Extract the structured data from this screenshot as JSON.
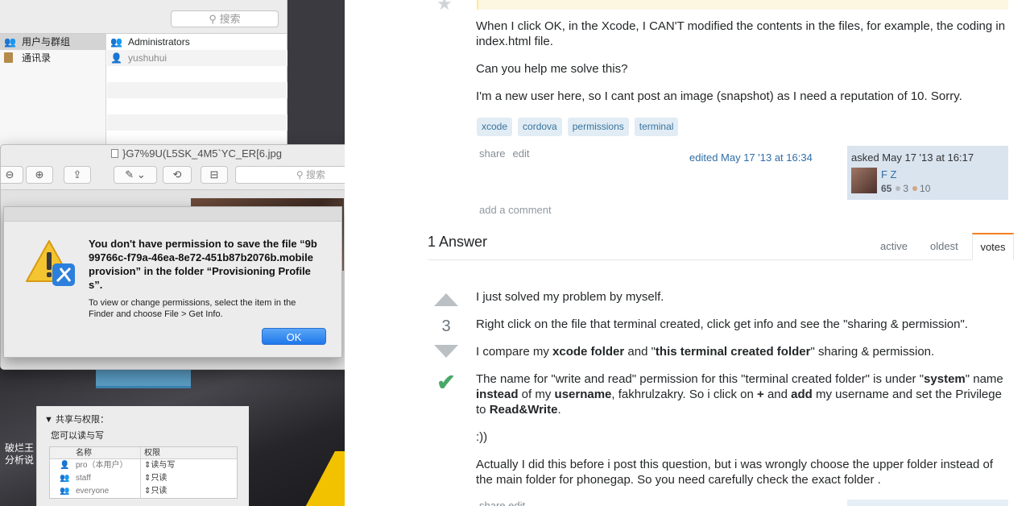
{
  "users_window": {
    "search_placeholder": "搜索",
    "sidebar": [
      {
        "label": "用户与群组",
        "icon": "users-icon",
        "selected": true
      },
      {
        "label": "通讯录",
        "icon": "address-book-icon",
        "selected": false
      }
    ],
    "list": [
      {
        "label": "Administrators",
        "icon": "group-icon"
      },
      {
        "label": "yushuhui",
        "icon": "user-icon"
      }
    ]
  },
  "preview_window": {
    "title": "}G7%9U(L5SK_4M5`YC_ER[6.jpg",
    "search_placeholder": "搜索"
  },
  "alert": {
    "message": "You don't have permission to save the file “9b99766c-f79a-46ea-8e72-451b87b2076b.mobileprovision” in the folder “Provisioning Profiles”.",
    "info": "To view or change permissions, select the item in the Finder and choose File > Get Info.",
    "ok_label": "OK"
  },
  "desktop": {
    "caption_line1": "破烂王",
    "caption_line2": "分析说"
  },
  "get_info": {
    "section_header": "▼ 共享与权限：",
    "subtitle": "您可以读与写",
    "columns": [
      "名称",
      "权限"
    ],
    "rows": [
      {
        "name": "pro（本用户）",
        "privilege": "读与写",
        "icon": "user-icon"
      },
      {
        "name": "staff",
        "privilege": "只读",
        "icon": "group-icon"
      },
      {
        "name": "everyone",
        "privilege": "只读",
        "icon": "everyone-icon"
      }
    ]
  },
  "question": {
    "paragraphs": [
      "When I click OK, in the Xcode, I CAN'T modified the contents in the files, for example, the coding in index.html file.",
      "Can you help me solve this?",
      "I'm a new user here, so I cant post an image (snapshot) as I need a reputation of 10. Sorry."
    ],
    "tags": [
      "xcode",
      "cordova",
      "permissions",
      "terminal"
    ],
    "share_label": "share",
    "edit_label": "edit",
    "edited": "edited May 17 '13 at 16:34",
    "asked": "asked May 17 '13 at 16:17",
    "user_name": "F Z",
    "reputation": "65",
    "silver_badges": "3",
    "bronze_badges": "10",
    "silver_color": "#b4b8bc",
    "bronze_color": "#d1a684",
    "add_comment": "add a comment"
  },
  "answers": {
    "header": "1 Answer",
    "tabs": [
      "active",
      "oldest",
      "votes"
    ],
    "active_tab": "votes",
    "vote_count": "3",
    "accepted_color": "#48a868",
    "p1": "I just solved my problem by myself.",
    "p2": "Right click on the file that terminal created, click get info and see the \"sharing & permission\".",
    "p3_a": "I compare my ",
    "p3_b": "xcode folder",
    "p3_c": " and \"",
    "p3_d": "this terminal created folder",
    "p3_e": "\" sharing & permission.",
    "p4_a": "The name for \"write and read\" permission for this \"terminal created folder\" is under \"",
    "p4_b": "system",
    "p4_c": "\" name ",
    "p4_d": "instead",
    "p4_e": " of my ",
    "p4_f": "username",
    "p4_g": ", fakhrulzakry. So i click on ",
    "p4_h": "+",
    "p4_i": " and ",
    "p4_j": "add",
    "p4_k": " my username and set the Privilege to ",
    "p4_l": "Read&Write",
    "p4_m": ".",
    "p5": ":))",
    "p6": "Actually I did this before i post this question, but i was wrongly choose the upper folder instead of the main folder for phonegap. So you need carefully check the exact folder .",
    "menu_share": "share",
    "menu_edit": "edit"
  }
}
